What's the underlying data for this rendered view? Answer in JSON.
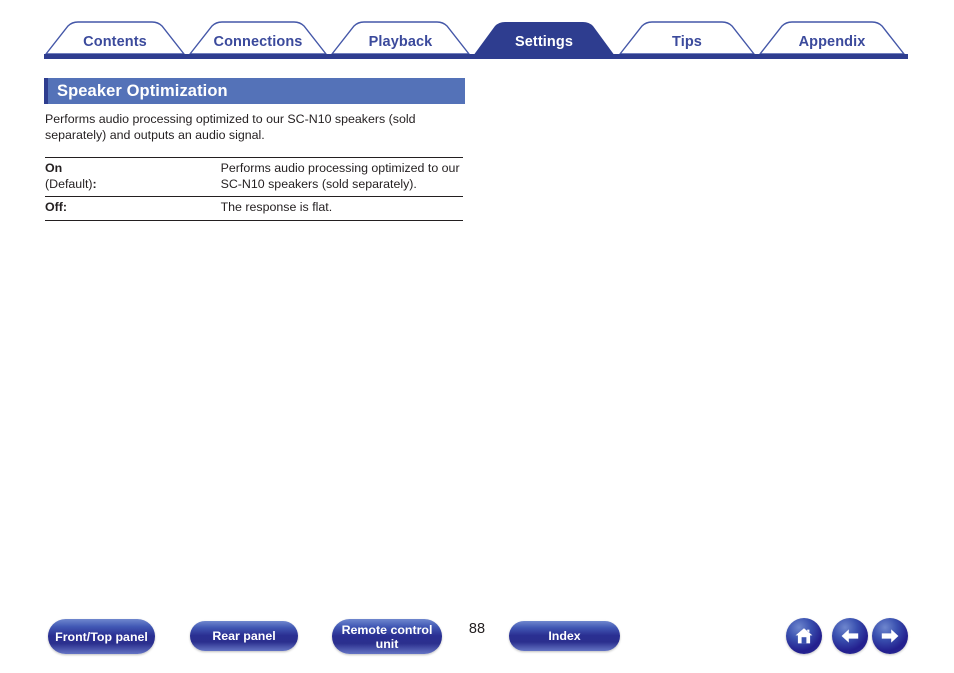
{
  "tabs": [
    {
      "label": "Contents",
      "name": "tab-contents",
      "active": false
    },
    {
      "label": "Connections",
      "name": "tab-connections",
      "active": false
    },
    {
      "label": "Playback",
      "name": "tab-playback",
      "active": false
    },
    {
      "label": "Settings",
      "name": "tab-settings",
      "active": true
    },
    {
      "label": "Tips",
      "name": "tab-tips",
      "active": false
    },
    {
      "label": "Appendix",
      "name": "tab-appendix",
      "active": false
    }
  ],
  "section": {
    "heading": "Speaker Optimization",
    "intro": "Performs audio processing optimized to our SC-N10 speakers (sold separately) and outputs an audio signal."
  },
  "options": [
    {
      "term_bold": "On",
      "term_rest": "(Default)",
      "term_colon": ":",
      "description": "Performs audio processing optimized to our SC-N10 speakers (sold separately)."
    },
    {
      "term_bold": "Off:",
      "term_rest": "",
      "term_colon": "",
      "description": "The response is flat."
    }
  ],
  "footer": {
    "buttons": [
      {
        "label": "Front/Top panel",
        "name": "front-top-panel-button"
      },
      {
        "label": "Rear panel",
        "name": "rear-panel-button"
      },
      {
        "label": "Remote control unit",
        "name": "remote-control-unit-button"
      },
      {
        "label": "Index",
        "name": "index-button"
      }
    ],
    "page_number": "88",
    "nav": [
      {
        "name": "home-icon",
        "glyph": "home"
      },
      {
        "name": "arrow-left-icon",
        "glyph": "left"
      },
      {
        "name": "arrow-right-icon",
        "glyph": "right"
      }
    ]
  },
  "colors": {
    "navy": "#3b4a9c",
    "heading_bg": "#5472b8",
    "heading_accent": "#2e3d8f",
    "text": "#231f20"
  }
}
